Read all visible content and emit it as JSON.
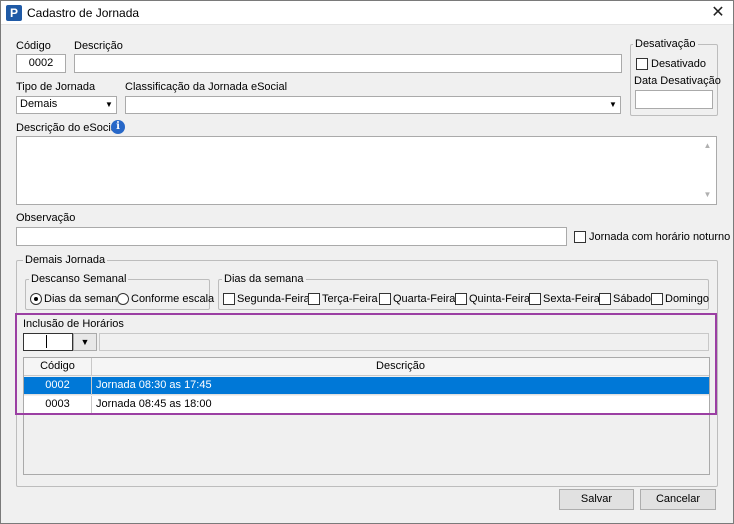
{
  "window": {
    "title": "Cadastro de Jornada"
  },
  "form": {
    "codigo_label": "Código",
    "codigo_value": "0002",
    "descricao_label": "Descrição",
    "descricao_value": "",
    "tipo_jornada_label": "Tipo de Jornada",
    "tipo_jornada_value": "Demais",
    "classificacao_label": "Classificação da Jornada eSocial",
    "classificacao_value": "",
    "descricao_esocial_label": "Descrição do eSocial",
    "observacao_label": "Observação",
    "observacao_value": "",
    "noturno_label": "Jornada com horário noturno"
  },
  "desativacao": {
    "legend": "Desativação",
    "desativado_label": "Desativado",
    "data_label": "Data Desativação",
    "data_value": ""
  },
  "demais": {
    "legend": "Demais Jornada",
    "descanso_legend": "Descanso Semanal",
    "descanso_options": [
      "Dias da semana",
      "Conforme escala"
    ],
    "dias_legend": "Dias da semana",
    "dias": [
      "Segunda-Feira",
      "Terça-Feira",
      "Quarta-Feira",
      "Quinta-Feira",
      "Sexta-Feira",
      "Sábado",
      "Domingo"
    ]
  },
  "horarios": {
    "legend": "Inclusão de Horários",
    "combo_value": "",
    "columns": [
      "Código",
      "Descrição"
    ],
    "rows": [
      {
        "codigo": "0002",
        "descricao": "Jornada 08:30 as 17:45"
      },
      {
        "codigo": "0003",
        "descricao": "Jornada 08:45 as 18:00"
      }
    ]
  },
  "buttons": {
    "salvar": "Salvar",
    "cancelar": "Cancelar"
  },
  "colors": {
    "selection": "#0078d7",
    "highlight": "#9b3fa3"
  },
  "icons": [
    "app-logo-icon",
    "close-icon",
    "info-icon",
    "chevron-down-icon",
    "scroll-up-icon",
    "scroll-down-icon"
  ]
}
